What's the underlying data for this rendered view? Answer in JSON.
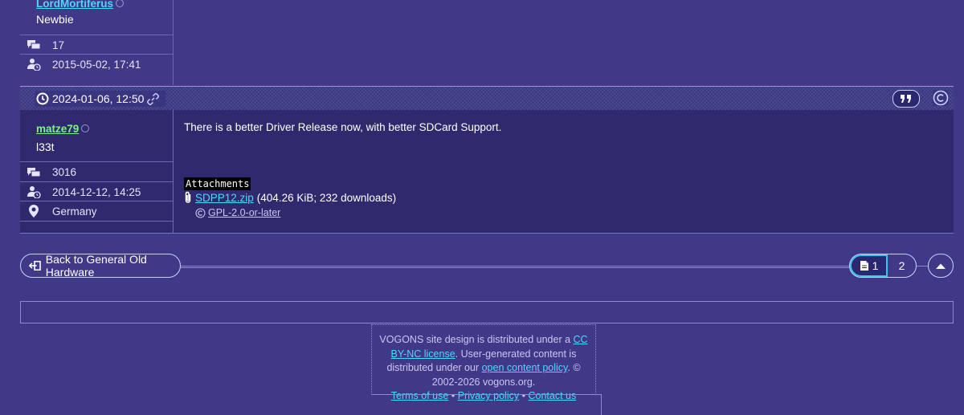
{
  "prev_post": {
    "username": "LordMortiferus",
    "rank": "Newbie",
    "post_count": "17",
    "join_date": "2015-05-02, 17:41"
  },
  "post": {
    "date": "2024-01-06, 12:50",
    "username": "matze79",
    "rank": "l33t",
    "post_count": "3016",
    "join_date": "2014-12-12, 14:25",
    "location": "Germany",
    "text": "There is a better Driver Release now, with better SDCard Support.",
    "attachments_label": "Attachments",
    "attachment_file": "SDPP12.zip",
    "attachment_meta": "(404.26 KiB; 232 downloads)",
    "attachment_license": "GPL-2.0-or-later"
  },
  "nav": {
    "back_label": "Back to General Old Hardware",
    "current_page": "1",
    "next_page": "2"
  },
  "footer": {
    "text_1": "VOGONS site design is distributed under a ",
    "link_cc": "CC BY-NC license",
    "text_2": ". User-generated content is distributed under our ",
    "link_ocp": "open content policy",
    "text_3": ". © 2002-2026 vogons.org.",
    "link_terms": "Terms of use",
    "link_privacy": "Privacy policy",
    "link_contact": "Contact us",
    "separator": "•"
  },
  "colors": {
    "background": "#3f3988",
    "accent": "#4dd6ff",
    "username_green": "#7cf28a"
  }
}
